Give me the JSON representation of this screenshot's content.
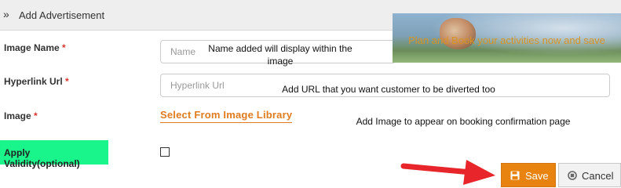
{
  "header": {
    "title": "Add Advertisement",
    "icon": "double-chevron-right-icon"
  },
  "form": {
    "image_name": {
      "label": "Image Name",
      "required_mark": "*",
      "placeholder": "Name"
    },
    "hyperlink_url": {
      "label": "Hyperlink Url",
      "required_mark": "*",
      "placeholder": "Hyperlink Url"
    },
    "image": {
      "label": "Image",
      "required_mark": "*",
      "link_label": "Select From Image Library"
    },
    "apply_validity": {
      "label": "Apply Validity(optional)",
      "checked": false,
      "highlight_color": "#19f58a"
    }
  },
  "annotations": {
    "name_note": "Name added will display within the image",
    "url_note": "Add URL that you want customer to be diverted too",
    "image_note": "Add Image to appear on booking confirmation page"
  },
  "banner": {
    "text": "Plan and Book your activities now and save",
    "text_color": "#d89324"
  },
  "buttons": {
    "save_label": "Save",
    "save_icon": "floppy-disk-icon",
    "cancel_label": "Cancel",
    "cancel_icon": "cancel-circle-icon"
  },
  "colors": {
    "accent": "#e8830f",
    "required": "#d9362b",
    "arrow": "#e8252a"
  }
}
